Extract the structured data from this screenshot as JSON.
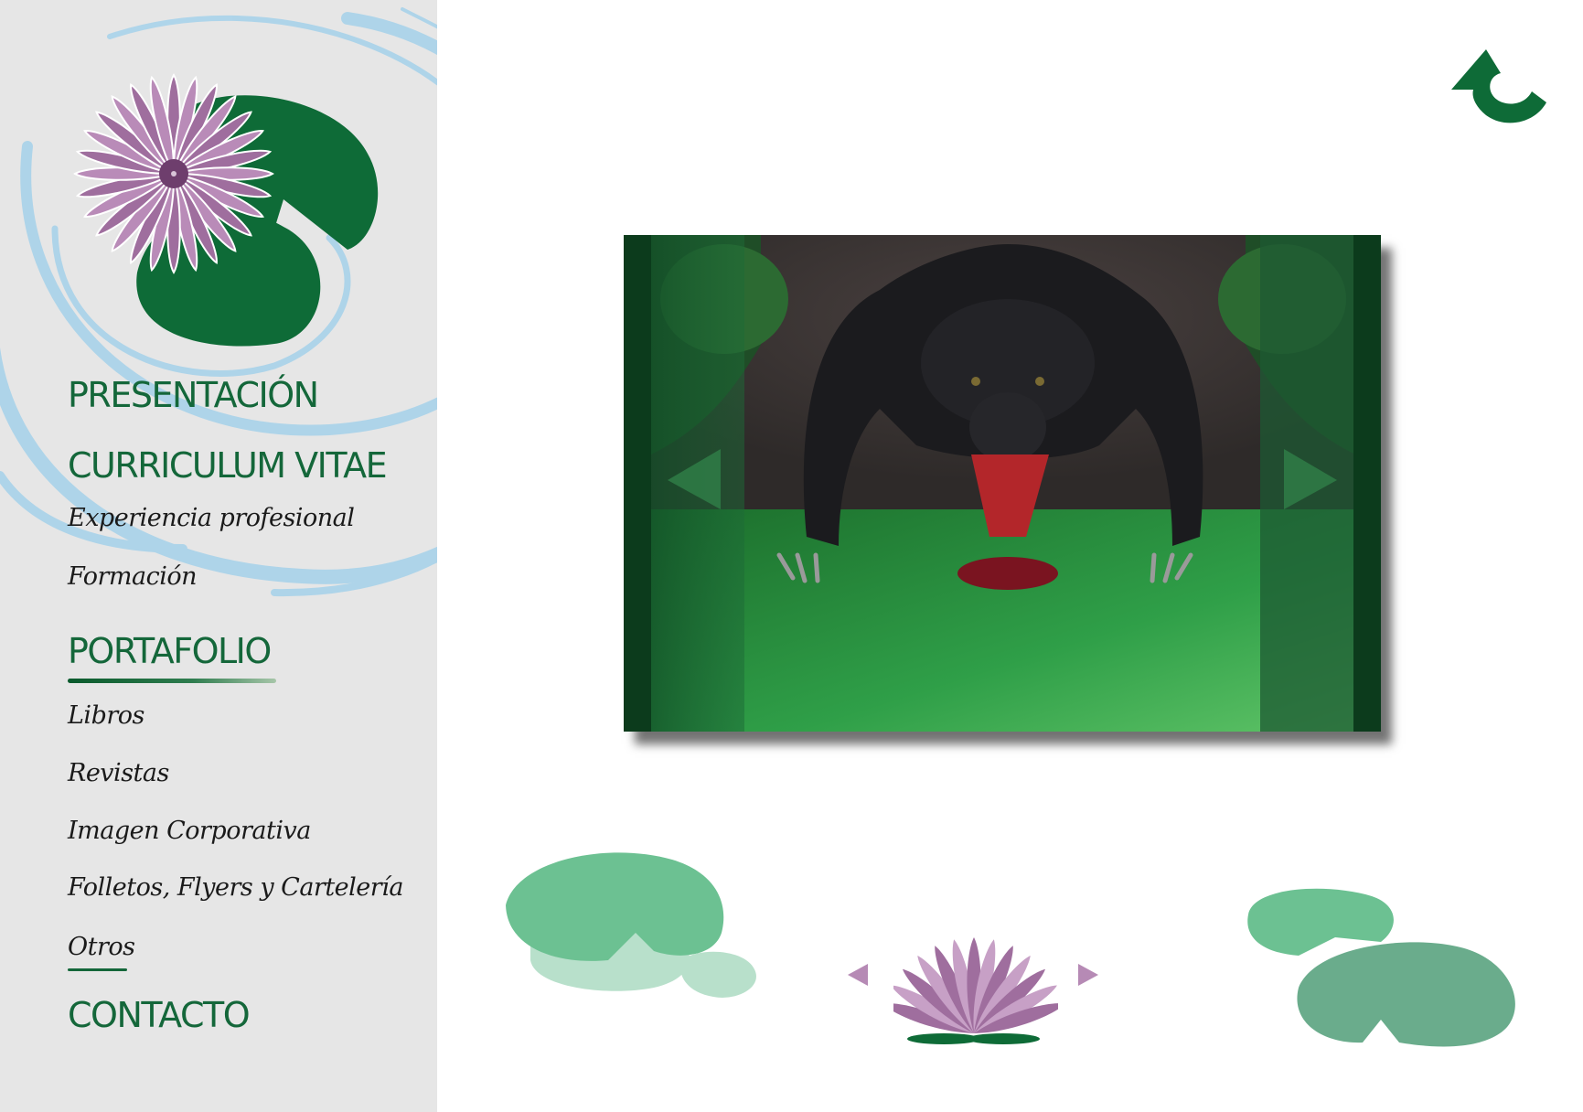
{
  "nav": {
    "presentacion": "PRESENTACIÓN",
    "curriculum": "CURRICULUM VITAE",
    "experiencia": "Experiencia profesional",
    "formacion": "Formación",
    "portafolio": "PORTAFOLIO",
    "libros": "Libros",
    "revistas": "Revistas",
    "imagen_corporativa": "Imagen Corporativa",
    "folletos": "Folletos, Flyers y Cartelería",
    "otros": "Otros",
    "contacto": "CONTACTO"
  },
  "active_section": "PORTAFOLIO",
  "active_subsection": "Otros",
  "icons": {
    "logo": "water-lily-logo",
    "back": "back-arrow-icon",
    "prev_image": "chevron-left-icon",
    "next_image": "chevron-right-icon",
    "prev_page": "triangle-left-icon",
    "next_page": "triangle-right-icon",
    "pager": "lotus-icon"
  },
  "colors": {
    "brand_green": "#14673a",
    "sidebar_bg": "#e6e6e6",
    "lotus_purple": "#9f6e9e",
    "water_blue": "#a9d3ea",
    "leaf_light": "#6cc192"
  }
}
